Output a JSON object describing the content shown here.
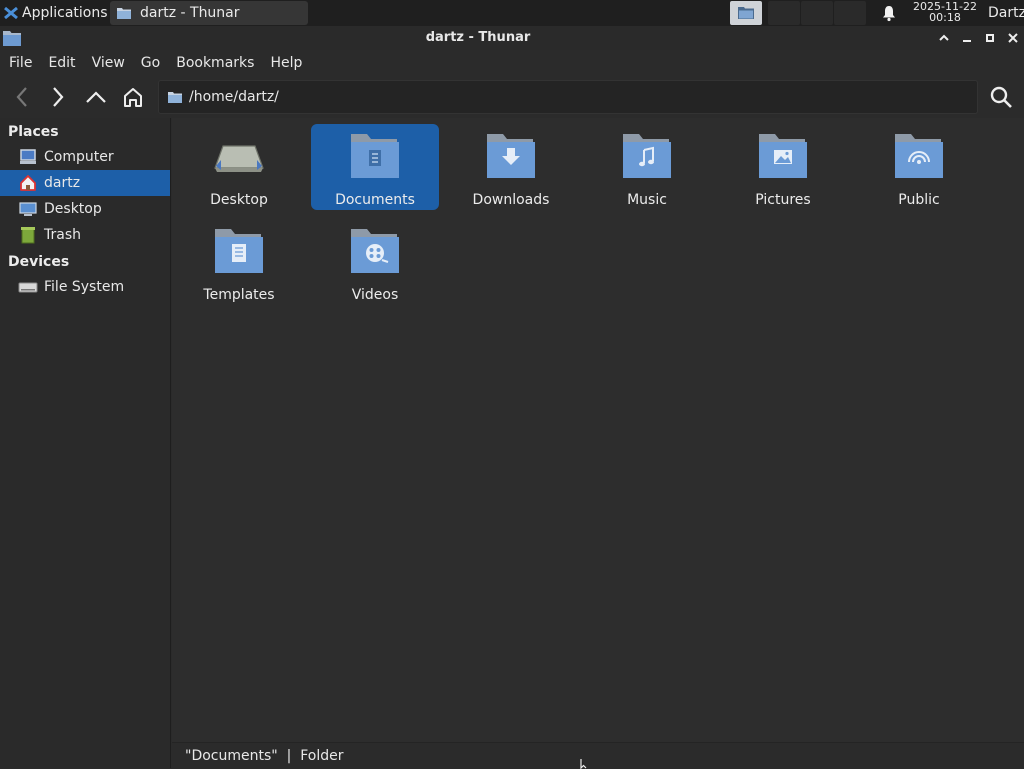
{
  "panel": {
    "applications_label": "Applications",
    "task_title": "dartz - Thunar",
    "date": "2025-11-22",
    "time": "00:18",
    "user": "Dartz"
  },
  "window": {
    "title": "dartz - Thunar"
  },
  "menu": {
    "file": "File",
    "edit": "Edit",
    "view": "View",
    "go": "Go",
    "bookmarks": "Bookmarks",
    "help": "Help"
  },
  "location": {
    "path": "/home/dartz/"
  },
  "sidebar": {
    "places_label": "Places",
    "devices_label": "Devices",
    "places": [
      {
        "label": "Computer",
        "icon": "computer-icon"
      },
      {
        "label": "dartz",
        "icon": "home-icon",
        "selected": true
      },
      {
        "label": "Desktop",
        "icon": "desktop-icon"
      },
      {
        "label": "Trash",
        "icon": "trash-icon"
      }
    ],
    "devices": [
      {
        "label": "File System",
        "icon": "drive-icon"
      }
    ]
  },
  "files": [
    {
      "name": "Desktop",
      "icon": "desktop-folder-icon"
    },
    {
      "name": "Documents",
      "icon": "documents-folder-icon",
      "selected": true
    },
    {
      "name": "Downloads",
      "icon": "downloads-folder-icon"
    },
    {
      "name": "Music",
      "icon": "music-folder-icon"
    },
    {
      "name": "Pictures",
      "icon": "pictures-folder-icon"
    },
    {
      "name": "Public",
      "icon": "public-folder-icon"
    },
    {
      "name": "Templates",
      "icon": "templates-folder-icon"
    },
    {
      "name": "Videos",
      "icon": "videos-folder-icon"
    }
  ],
  "status": {
    "text": "\"Documents\"  |  Folder"
  },
  "colors": {
    "selection": "#1d5fa8",
    "background": "#2d2d2d",
    "folder_blue": "#6b9bd6"
  }
}
